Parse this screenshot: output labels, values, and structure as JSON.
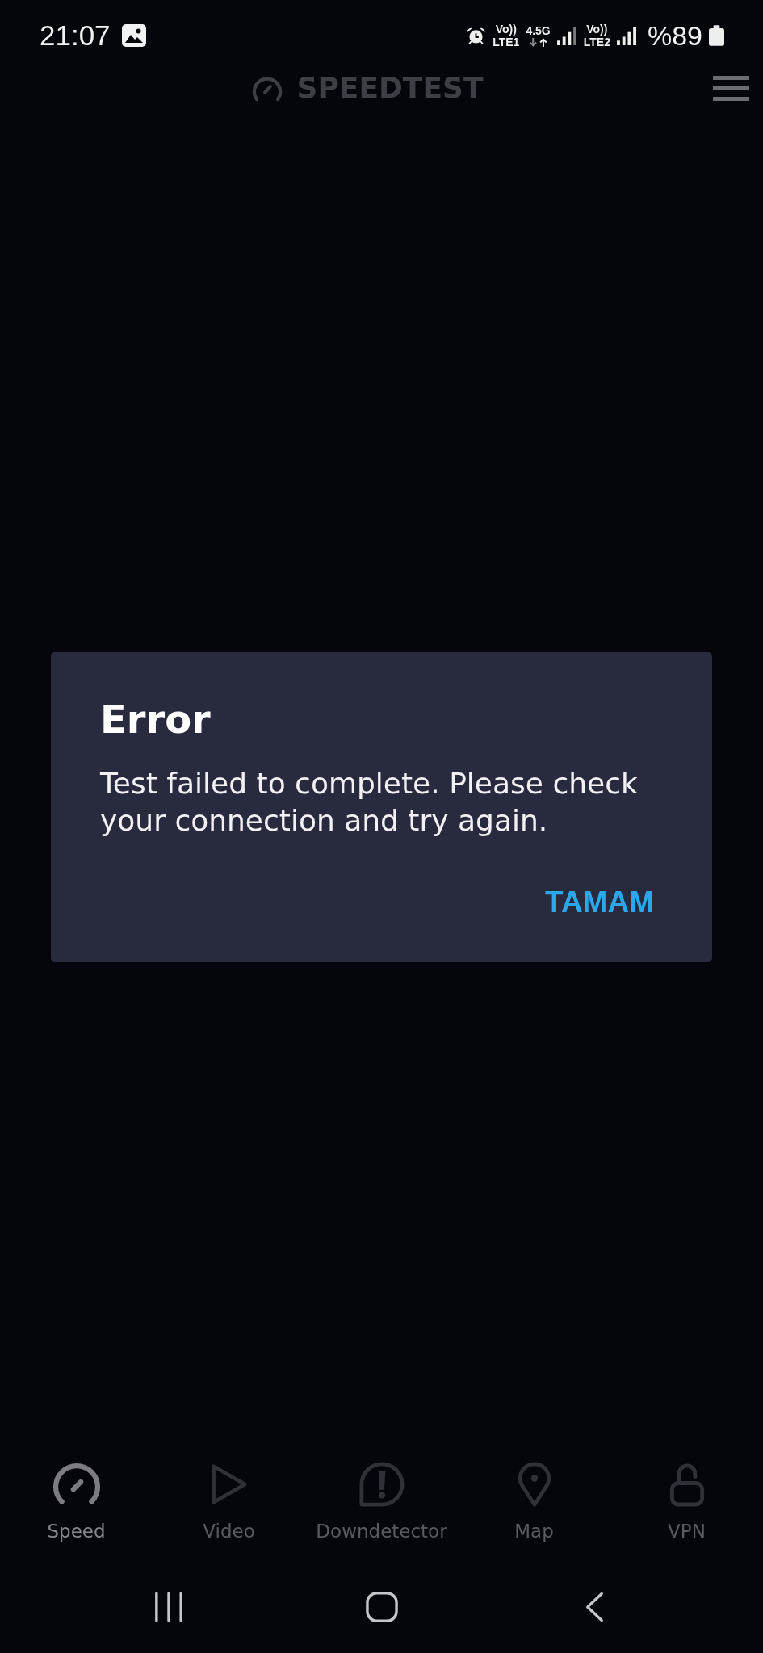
{
  "status_bar": {
    "time": "21:07",
    "sims": [
      {
        "volte": "Vo))",
        "network": "LTE1",
        "data_type": "4.5G"
      },
      {
        "volte": "Vo))",
        "network": "LTE2"
      }
    ],
    "battery": "%89"
  },
  "header": {
    "title": "SPEEDTEST"
  },
  "dialog": {
    "title": "Error",
    "message": "Test failed to complete. Please check your connection and try again.",
    "button": "TAMAM"
  },
  "tabs": [
    {
      "kind": "speed",
      "label": "Speed",
      "selected": true
    },
    {
      "kind": "video",
      "label": "Video",
      "selected": false
    },
    {
      "kind": "downdetector",
      "label": "Downdetector",
      "selected": false
    },
    {
      "kind": "map",
      "label": "Map",
      "selected": false
    },
    {
      "kind": "vpn",
      "label": "VPN",
      "selected": false
    }
  ]
}
